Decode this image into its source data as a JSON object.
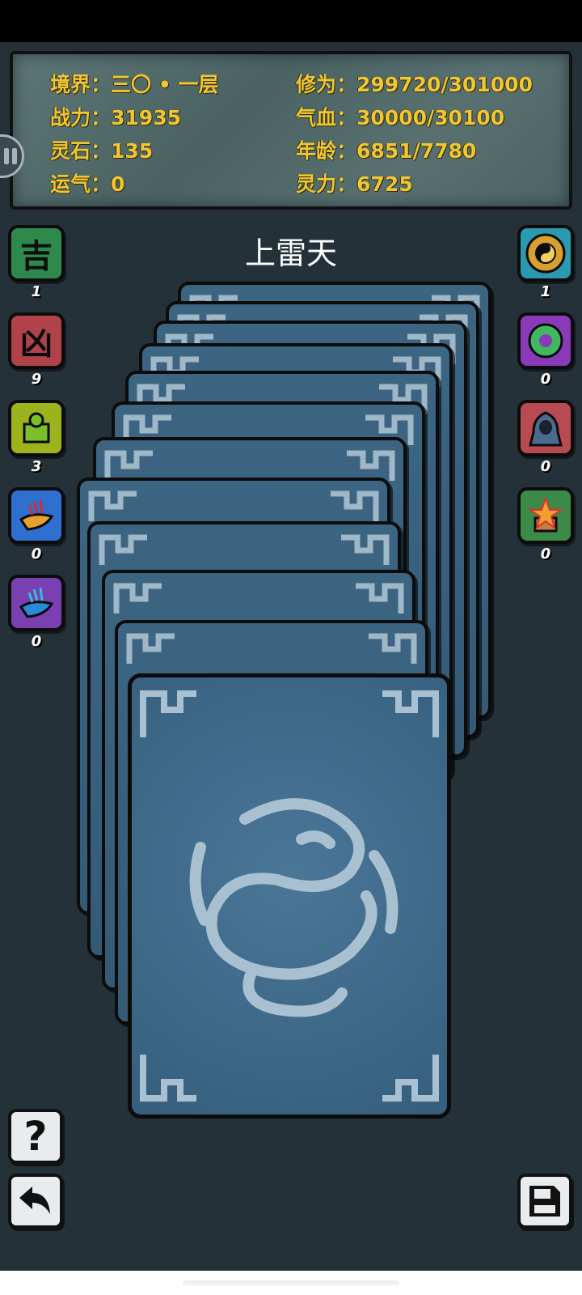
{
  "stats": {
    "realm_label": "境界：",
    "realm_value": "三〇 • 一层",
    "power_label": "战力：",
    "power_value": "31935",
    "spirit_stone_label": "灵石：",
    "spirit_stone_value": "135",
    "luck_label": "运气：",
    "luck_value": "0",
    "cultivation_label": "修为：",
    "cultivation_value": "299720/301000",
    "hp_label": "气血：",
    "hp_value": "30000/30100",
    "age_label": "年龄：",
    "age_value": "6851/7780",
    "spirit_power_label": "灵力：",
    "spirit_power_value": "6725"
  },
  "realm_title": "上雷天",
  "left_items": [
    {
      "icon": "fortune-icon",
      "glyph": "吉",
      "count": "1",
      "color": "#2e8a4c"
    },
    {
      "icon": "misfortune-icon",
      "glyph": "凶",
      "count": "9",
      "color": "#b0424a"
    },
    {
      "icon": "jade-seal-icon",
      "glyph": "",
      "count": "3",
      "color": "#9cb31e"
    },
    {
      "icon": "fire-scroll-icon",
      "glyph": "",
      "count": "0",
      "color": "#2f6fd0"
    },
    {
      "icon": "ice-scroll-icon",
      "glyph": "",
      "count": "0",
      "color": "#7a3fb0"
    }
  ],
  "right_items": [
    {
      "icon": "taiji-compass-icon",
      "count": "1",
      "color": "#2a9ab0"
    },
    {
      "icon": "jade-orb-icon",
      "count": "0",
      "color": "#8a3ab8"
    },
    {
      "icon": "hooded-figure-icon",
      "count": "0",
      "color": "#b84a52"
    },
    {
      "icon": "formation-crystal-icon",
      "count": "0",
      "color": "#3c8a48"
    }
  ],
  "colors": {
    "background": "#253139",
    "stat_text": "#f2c630",
    "card_back": "#3d6888"
  }
}
